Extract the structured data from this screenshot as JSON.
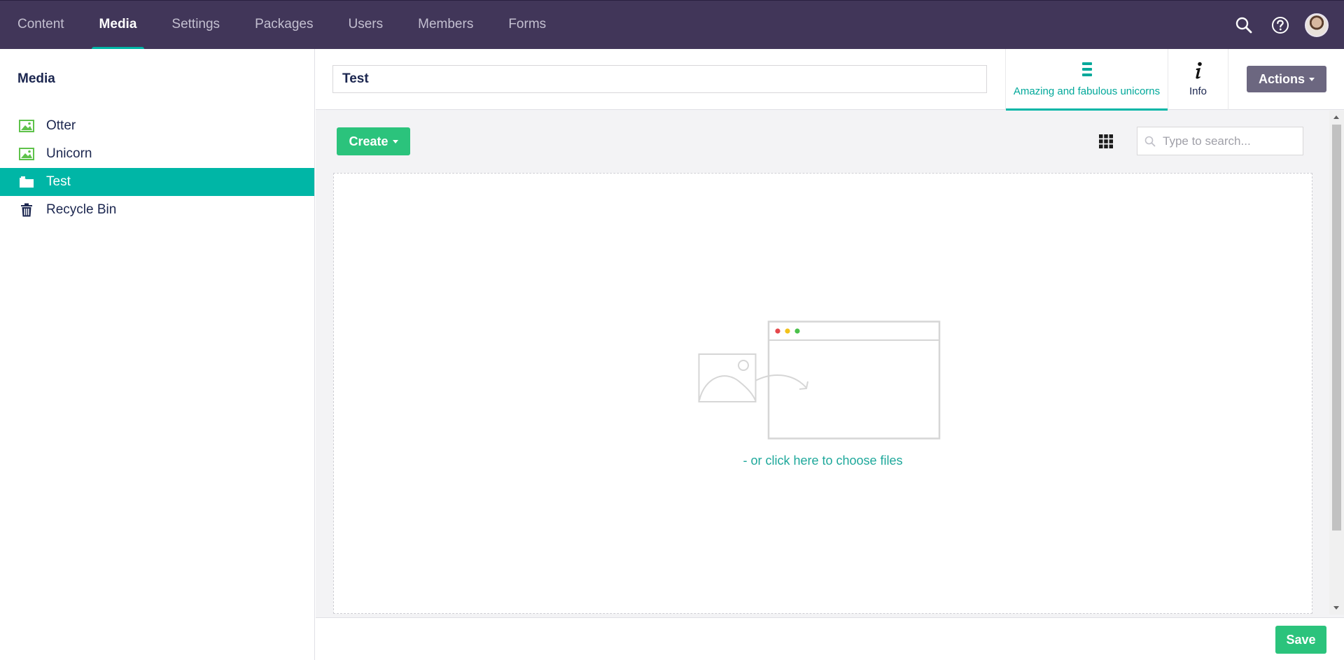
{
  "topnav": {
    "sections": [
      {
        "label": "Content",
        "active": false
      },
      {
        "label": "Media",
        "active": true
      },
      {
        "label": "Settings",
        "active": false
      },
      {
        "label": "Packages",
        "active": false
      },
      {
        "label": "Users",
        "active": false
      },
      {
        "label": "Members",
        "active": false
      },
      {
        "label": "Forms",
        "active": false
      }
    ],
    "tools": [
      "search-icon",
      "help-icon",
      "user-avatar"
    ],
    "accent_color": "#00b6a6",
    "background_color": "#413659"
  },
  "sidebar": {
    "title": "Media",
    "items": [
      {
        "label": "Otter",
        "icon": "picture-icon",
        "selected": false
      },
      {
        "label": "Unicorn",
        "icon": "picture-icon",
        "selected": false
      },
      {
        "label": "Test",
        "icon": "folder-icon",
        "selected": true
      },
      {
        "label": "Recycle Bin",
        "icon": "trash-icon",
        "selected": false
      }
    ],
    "selected_color": "#00b6a6"
  },
  "editor": {
    "name_value": "Test",
    "apps": [
      {
        "label": "Amazing and fabulous unicorns",
        "icon": "list-icon",
        "active": true
      },
      {
        "label": "Info",
        "icon": "info-icon",
        "active": false
      }
    ],
    "actions_label": "Actions",
    "create_label": "Create",
    "layout_toggle_icon": "grid-icon",
    "search_placeholder": "Type to search...",
    "dropzone_link": "- or click here to choose files",
    "save_label": "Save",
    "button_green": "#2bc37c"
  }
}
